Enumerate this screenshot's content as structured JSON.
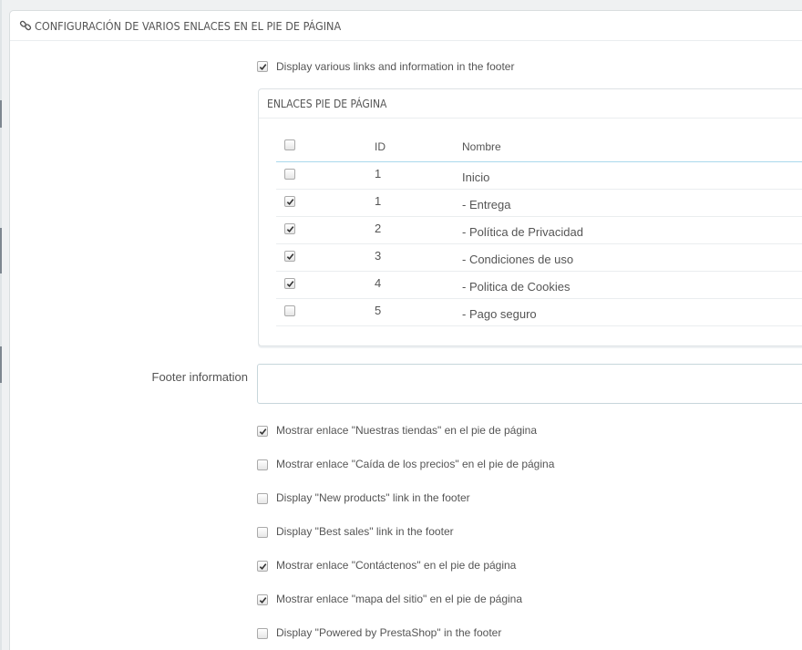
{
  "panel": {
    "title": "CONFIGURACIÓN DE VARIOS ENLACES EN EL PIE DE PÁGINA",
    "title_icon": "link-icon"
  },
  "display_links": {
    "label": "Display various links and information in the footer",
    "checked": true
  },
  "links_table": {
    "heading": "ENLACES PIE DE PÁGINA",
    "columns": [
      "ID",
      "Nombre"
    ],
    "rows": [
      {
        "id": "1",
        "name": "Inicio",
        "checked": false
      },
      {
        "id": "1",
        "name": "- Entrega",
        "checked": true
      },
      {
        "id": "2",
        "name": "- Política de Privacidad",
        "checked": true
      },
      {
        "id": "3",
        "name": "- Condiciones de uso",
        "checked": true
      },
      {
        "id": "4",
        "name": "- Politica de Cookies",
        "checked": true
      },
      {
        "id": "5",
        "name": "- Pago seguro",
        "checked": false
      }
    ]
  },
  "footer_info": {
    "label": "Footer information",
    "value": ""
  },
  "options": [
    {
      "label": "Mostrar enlace \"Nuestras tiendas\" en el pie de página",
      "checked": true
    },
    {
      "label": "Mostrar enlace \"Caída de los precios\" en el pie de página",
      "checked": false
    },
    {
      "label": "Display \"New products\" link in the footer",
      "checked": false
    },
    {
      "label": "Display \"Best sales\" link in the footer",
      "checked": false
    },
    {
      "label": "Mostrar enlace \"Contáctenos\" en el pie de página",
      "checked": true
    },
    {
      "label": "Mostrar enlace \"mapa del sitio\" en el pie de página",
      "checked": true
    },
    {
      "label": "Display \"Powered by PrestaShop\" in the footer",
      "checked": false
    }
  ],
  "colors": {
    "background": "#eff1f2",
    "panel": "#ffffff",
    "table_header_line": "#a9d9ec",
    "text": "#555555"
  }
}
